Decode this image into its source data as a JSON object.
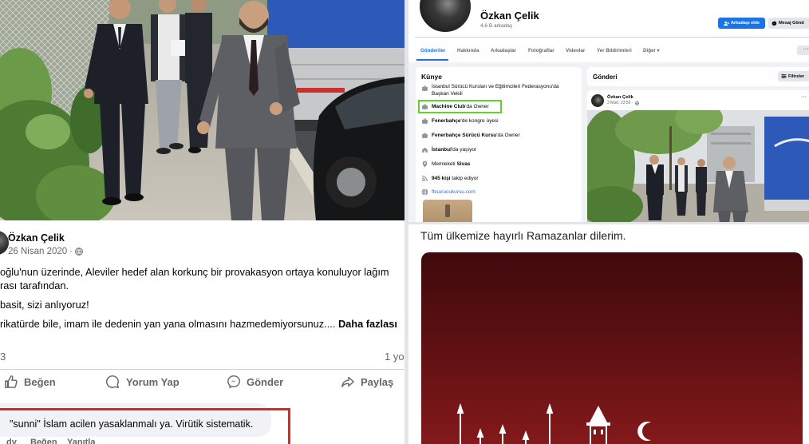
{
  "left_post": {
    "author": "Özkan Çelik",
    "date": "26 Nisan 2020",
    "date_sep": "·",
    "text_lines": [
      "oğlu'nun üzerinde, Aleviler hedef alan korkunç bir provakasyon ortaya konuluyor lağım",
      "rası tarafından.",
      "basit, sizi anlıyoruz!",
      "rikatürde bile, imam ile dedenin yan yana olmasını hazmedemiyorsunuz.... "
    ],
    "see_more": "Daha fazlası",
    "reaction_count": "3",
    "comment_count": "1 yo",
    "actions": {
      "like": "Beğen",
      "comment": "Yorum Yap",
      "send": "Gönder",
      "share": "Paylaş"
    },
    "comment": {
      "text": "\"sunni\" İslam acilen yasaklanmalı ya. Virütik sistematik.",
      "age": "dy",
      "like": "Beğen",
      "reply": "Yanıtla"
    },
    "highlight_color": "#e0271d"
  },
  "profile": {
    "name": "Özkan Çelik",
    "friends": "4,6 B arkadaş",
    "add_friend": "Arkadaşı ekle",
    "message": "Mesaj Gönd",
    "tabs": [
      "Gönderiler",
      "Hakkında",
      "Arkadaşlar",
      "Fotoğraflar",
      "Videolar",
      "Yer Bildirimleri",
      "Diğer ▾"
    ],
    "more": "···",
    "intro": {
      "title": "Künye",
      "first_item_lines": [
        "İstanbul Sürücü Kursları ve Eğitimcileri Federasyonu'da",
        "Başkan Vekili"
      ],
      "items": [
        {
          "pre": "",
          "bold": "Machine Club",
          "post": "'da Owner",
          "icon": "briefcase-icon"
        },
        {
          "pre": "",
          "bold": "Fenerbahçe",
          "post": "'de kongre üyesi",
          "icon": "briefcase-icon"
        },
        {
          "pre": "",
          "bold": "Fenerbahçe Sürücü Kursu",
          "post": "'da Owner",
          "icon": "briefcase-icon"
        },
        {
          "pre": "",
          "bold": "İstanbul",
          "post": "'da yaşıyor",
          "icon": "home-icon"
        },
        {
          "pre": "Memleketi ",
          "bold": "Sivas",
          "post": "",
          "icon": "location-icon"
        },
        {
          "pre": "",
          "bold": "945 kişi",
          "post": " takip ediyor",
          "icon": "follow-icon"
        }
      ],
      "link": "fbsurucukursu.com",
      "highlight_color": "#5fd42a"
    },
    "posts_header": {
      "title": "Gönderi",
      "filter": "Filtreler"
    },
    "post": {
      "author": "Özkan Çelik",
      "date": "3 Mart, 23:50 ·",
      "more": "···"
    },
    "accent_color": "#1b74e4"
  },
  "ramadan_post": {
    "text": "Tüm ülkemize hayırlı Ramazanlar dilerim.",
    "card_color": "#5d1012"
  }
}
